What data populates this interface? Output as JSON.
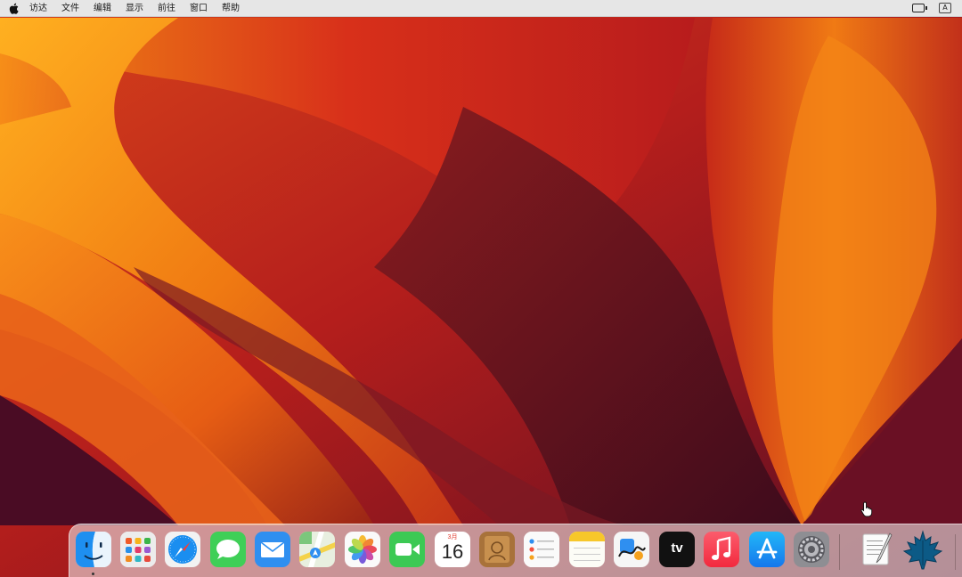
{
  "menubar": {
    "apple_icon": "apple-logo-icon",
    "items": [
      "访达",
      "文件",
      "编辑",
      "显示",
      "前往",
      "窗口",
      "帮助"
    ],
    "status_icons": [
      "screen-mirroring-icon",
      "input-source-icon"
    ],
    "input_source_label": "A"
  },
  "desktop": {
    "wallpaper": "macOS Ventura orange wallpaper",
    "colors": {
      "deep": "#5a0d1e",
      "red": "#c4221a",
      "orange": "#f0700f",
      "amber": "#ffa01a"
    }
  },
  "dock": {
    "apps": [
      {
        "name": "Finder",
        "icon": "finder-icon",
        "running": true
      },
      {
        "name": "Launchpad",
        "icon": "launchpad-icon"
      },
      {
        "name": "Safari",
        "icon": "safari-icon"
      },
      {
        "name": "Messages",
        "icon": "messages-icon"
      },
      {
        "name": "Mail",
        "icon": "mail-icon"
      },
      {
        "name": "Maps",
        "icon": "maps-icon"
      },
      {
        "name": "Photos",
        "icon": "photos-icon"
      },
      {
        "name": "FaceTime",
        "icon": "facetime-icon"
      },
      {
        "name": "Calendar",
        "icon": "calendar-icon",
        "month": "3月",
        "day": "16"
      },
      {
        "name": "Contacts",
        "icon": "contacts-icon"
      },
      {
        "name": "Reminders",
        "icon": "reminders-icon"
      },
      {
        "name": "Notes",
        "icon": "notes-icon"
      },
      {
        "name": "Freeform",
        "icon": "freeform-icon"
      },
      {
        "name": "TV",
        "icon": "apple-tv-icon",
        "label": "tv"
      },
      {
        "name": "Music",
        "icon": "music-icon"
      },
      {
        "name": "App Store",
        "icon": "app-store-icon"
      },
      {
        "name": "System Settings",
        "icon": "system-settings-icon"
      },
      {
        "name": "TextEdit",
        "icon": "textedit-icon"
      },
      {
        "name": "Maple",
        "icon": "maple-leaf-icon"
      }
    ]
  }
}
